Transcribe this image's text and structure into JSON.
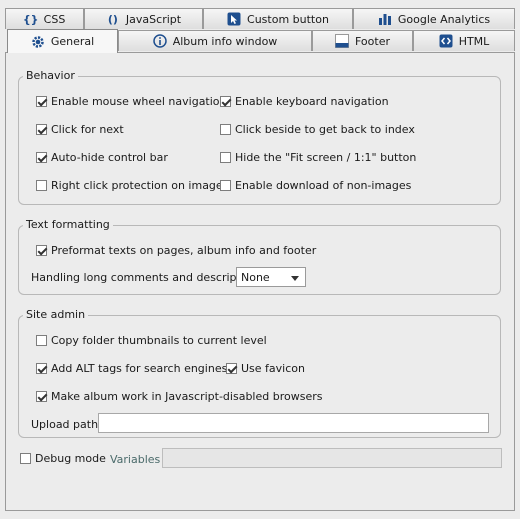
{
  "tabs_top": [
    {
      "label": "CSS",
      "icon": "braces-icon"
    },
    {
      "label": "JavaScript",
      "icon": "parentheses-icon"
    },
    {
      "label": "Custom button",
      "icon": "cursor-icon"
    },
    {
      "label": "Google Analytics",
      "icon": "bar-chart-icon"
    }
  ],
  "tabs_bottom": [
    {
      "label": "General",
      "icon": "gear-icon",
      "active": true
    },
    {
      "label": "Album info window",
      "icon": "info-icon"
    },
    {
      "label": "Footer",
      "icon": "footer-icon"
    },
    {
      "label": "HTML",
      "icon": "code-icon"
    }
  ],
  "behavior": {
    "title": "Behavior",
    "options": [
      {
        "label": "Enable mouse wheel navigation",
        "checked": true
      },
      {
        "label": "Enable keyboard navigation",
        "checked": true
      },
      {
        "label": "Click for next",
        "checked": true
      },
      {
        "label": "Click beside to get back to index",
        "checked": false
      },
      {
        "label": "Auto-hide control bar",
        "checked": true
      },
      {
        "label": "Hide the \"Fit screen / 1:1\" button",
        "checked": false
      },
      {
        "label": "Right click protection on images",
        "checked": false
      },
      {
        "label": "Enable download of non-images",
        "checked": false
      }
    ]
  },
  "text_formatting": {
    "title": "Text formatting",
    "preformat": {
      "label": "Preformat texts on pages, album info and footer",
      "checked": true
    },
    "long_comments_label": "Handling long comments and descriptions",
    "long_comments_value": "None"
  },
  "site_admin": {
    "title": "Site admin",
    "copy_thumbs": {
      "label": "Copy folder thumbnails to current level",
      "checked": false
    },
    "alt_tags": {
      "label": "Add ALT tags for search engines",
      "checked": true
    },
    "favicon": {
      "label": "Use favicon",
      "checked": true
    },
    "js_disabled": {
      "label": "Make album work in Javascript-disabled browsers",
      "checked": true
    },
    "upload_path_label": "Upload path",
    "upload_path_value": ""
  },
  "debug": {
    "label": "Debug mode",
    "checked": false,
    "variables_label": "Variables",
    "variables_value": ""
  },
  "colors": {
    "accent_blue": "#1f4f8f",
    "group_border": "#b8b8b8"
  }
}
